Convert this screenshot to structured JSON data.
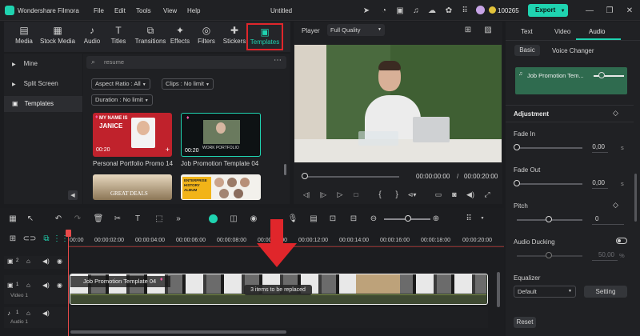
{
  "app": {
    "name": "Wondershare Filmora",
    "menu": [
      "File",
      "Edit",
      "Tools",
      "View",
      "Help"
    ],
    "doc_title": "Untitled",
    "credits": "100265",
    "export_label": "Export"
  },
  "media_tabs": [
    {
      "label": "Media",
      "icon": "media-icon"
    },
    {
      "label": "Stock Media",
      "icon": "stock-media-icon"
    },
    {
      "label": "Audio",
      "icon": "audio-icon"
    },
    {
      "label": "Titles",
      "icon": "titles-icon"
    },
    {
      "label": "Transitions",
      "icon": "transitions-icon"
    },
    {
      "label": "Effects",
      "icon": "effects-icon"
    },
    {
      "label": "Filters",
      "icon": "filters-icon"
    },
    {
      "label": "Stickers",
      "icon": "stickers-icon"
    },
    {
      "label": "Templates",
      "icon": "templates-icon"
    }
  ],
  "sidebar": {
    "items": [
      "Mine",
      "Split Screen",
      "Templates"
    ]
  },
  "search": {
    "placeholder": "resume"
  },
  "filters": {
    "aspect": "Aspect Ratio : All",
    "clips": "Clips : No limit",
    "duration": "Duration : No limit"
  },
  "templates": [
    {
      "name": "Personal Portfolio Promo 14",
      "duration": "00:20",
      "thumb_line1": "MY NAME IS",
      "thumb_line2": "JANICE"
    },
    {
      "name": "Job Promotion Template 04",
      "duration": "00:20",
      "thumb_line1": "WORK PORTFOLIO"
    },
    {
      "thumb_line1": "GREAT DEALS"
    },
    {
      "thumb_line1": "ENTERPRISE",
      "thumb_line2": "HISTORY",
      "thumb_line3": "ALBUM"
    }
  ],
  "player": {
    "label": "Player",
    "quality": "Full Quality",
    "current": "00:00:00:00",
    "separator": "/",
    "total": "00:00:20:00"
  },
  "right_panel": {
    "tabs": [
      "Text",
      "Video",
      "Audio"
    ],
    "subtabs": [
      "Basic",
      "Voice Changer"
    ],
    "clip_name": "Job Promotion Tem...",
    "adjustment": "Adjustment",
    "fade_in": {
      "label": "Fade In",
      "value": "0,00",
      "unit": "s"
    },
    "fade_out": {
      "label": "Fade Out",
      "value": "0,00",
      "unit": "s"
    },
    "pitch": {
      "label": "Pitch",
      "value": "0"
    },
    "ducking": {
      "label": "Audio Ducking",
      "value": "50,00",
      "unit": "%"
    },
    "equalizer": {
      "label": "Equalizer",
      "preset": "Default",
      "setting_label": "Setting"
    },
    "reset_label": "Reset"
  },
  "timeline": {
    "ruler": [
      "00:00",
      "00:00:02:00",
      "00:00:04:00",
      "00:00:06:00",
      "00:00:08:00",
      "00:00:10:00",
      "00:00:12:00",
      "00:00:14:00",
      "00:00:16:00",
      "00:00:18:00",
      "00:00:20:00"
    ],
    "tracks": [
      {
        "num": "2"
      },
      {
        "num": "1",
        "label": "Video 1"
      },
      {
        "num": "1",
        "label": "Audio 1"
      }
    ],
    "clip_label": "Job Promotion Template 04",
    "replace_text": "3 items to be replaced"
  },
  "colors": {
    "accent": "#1fd3b0",
    "highlight_box": "#e0262b",
    "arrow": "#e0262b",
    "playhead": "#e84a4a",
    "clip_border": "#f0f0f0",
    "audio_clip": "#2f6b4f"
  }
}
